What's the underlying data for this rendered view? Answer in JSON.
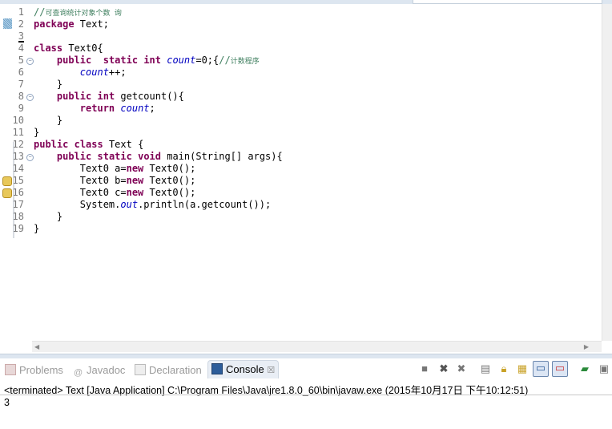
{
  "editor": {
    "lines": [
      {
        "n": "1",
        "tokens": [
          [
            "cm",
            "//"
          ],
          [
            "cmz",
            "可查询统计对象个数 询"
          ]
        ]
      },
      {
        "n": "2",
        "tokens": [
          [
            "kw",
            "package"
          ],
          [
            "pl",
            " Text;"
          ]
        ]
      },
      {
        "n": "3",
        "tokens": []
      },
      {
        "n": "4",
        "tokens": [
          [
            "kw",
            "class"
          ],
          [
            "pl",
            " Text0{"
          ]
        ]
      },
      {
        "n": "5",
        "fold": true,
        "tokens": [
          [
            "pl",
            "    "
          ],
          [
            "kw",
            "public"
          ],
          [
            "pl",
            "  "
          ],
          [
            "kw",
            "static"
          ],
          [
            "pl",
            " "
          ],
          [
            "kw",
            "int"
          ],
          [
            "pl",
            " "
          ],
          [
            "fld",
            "count"
          ],
          [
            "pl",
            "=0;{"
          ],
          [
            "cm",
            "//"
          ],
          [
            "cmz",
            "计数程序"
          ]
        ]
      },
      {
        "n": "6",
        "tokens": [
          [
            "pl",
            "        "
          ],
          [
            "fld",
            "count"
          ],
          [
            "pl",
            "++;"
          ]
        ]
      },
      {
        "n": "7",
        "tokens": [
          [
            "pl",
            "    }"
          ]
        ]
      },
      {
        "n": "8",
        "fold": true,
        "tokens": [
          [
            "pl",
            "    "
          ],
          [
            "kw",
            "public"
          ],
          [
            "pl",
            " "
          ],
          [
            "kw",
            "int"
          ],
          [
            "pl",
            " getcount(){"
          ]
        ]
      },
      {
        "n": "9",
        "tokens": [
          [
            "pl",
            "        "
          ],
          [
            "kw",
            "return"
          ],
          [
            "pl",
            " "
          ],
          [
            "fld",
            "count"
          ],
          [
            "pl",
            ";"
          ]
        ]
      },
      {
        "n": "10",
        "tokens": [
          [
            "pl",
            "    }"
          ]
        ]
      },
      {
        "n": "11",
        "tokens": [
          [
            "pl",
            "}"
          ]
        ]
      },
      {
        "n": "12",
        "tokens": [
          [
            "kw",
            "public"
          ],
          [
            "pl",
            " "
          ],
          [
            "kw",
            "class"
          ],
          [
            "pl",
            " Text {"
          ]
        ]
      },
      {
        "n": "13",
        "fold": true,
        "tokens": [
          [
            "pl",
            "    "
          ],
          [
            "kw",
            "public"
          ],
          [
            "pl",
            " "
          ],
          [
            "kw",
            "static"
          ],
          [
            "pl",
            " "
          ],
          [
            "kw",
            "void"
          ],
          [
            "pl",
            " main(String[] args){"
          ]
        ]
      },
      {
        "n": "14",
        "tokens": [
          [
            "pl",
            "        Text0 a="
          ],
          [
            "kw",
            "new"
          ],
          [
            "pl",
            " Text0();"
          ]
        ]
      },
      {
        "n": "15",
        "warn": true,
        "tokens": [
          [
            "pl",
            "        Text0 b="
          ],
          [
            "kw",
            "new"
          ],
          [
            "pl",
            " Text0();"
          ]
        ]
      },
      {
        "n": "16",
        "warn": true,
        "tokens": [
          [
            "pl",
            "        Text0 c="
          ],
          [
            "kw",
            "new"
          ],
          [
            "pl",
            " Text0();"
          ]
        ]
      },
      {
        "n": "17",
        "tokens": [
          [
            "pl",
            "        System."
          ],
          [
            "fld",
            "out"
          ],
          [
            "pl",
            ".println(a.getcount());"
          ]
        ]
      },
      {
        "n": "18",
        "tokens": [
          [
            "pl",
            "    }"
          ]
        ]
      },
      {
        "n": "19",
        "tokens": [
          [
            "pl",
            "}"
          ]
        ]
      }
    ]
  },
  "panel": {
    "tabs": [
      {
        "label": "Problems",
        "icon": "problems-icon",
        "active": false
      },
      {
        "label": "Javadoc",
        "icon": "at-icon",
        "active": false
      },
      {
        "label": "Declaration",
        "icon": "declaration-icon",
        "active": false
      },
      {
        "label": "Console",
        "icon": "console-icon",
        "active": true
      }
    ],
    "close_glyph": "☒",
    "console_header": "<terminated> Text [Java Application] C:\\Program Files\\Java\\jre1.8.0_60\\bin\\javaw.exe (2015年10月17日 下午10:12:51)",
    "output": "3"
  },
  "colors": {
    "keyword": "#7f0055",
    "field": "#0000c0",
    "comment": "#3f7f5f"
  }
}
